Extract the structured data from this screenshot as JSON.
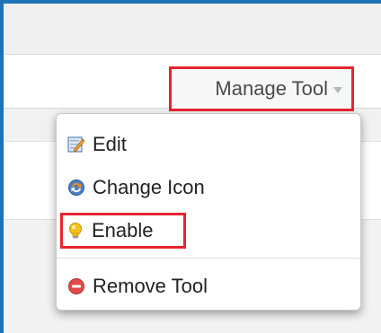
{
  "toolbar": {
    "manage_label": "Manage Tool"
  },
  "menu": {
    "items": [
      {
        "label": "Edit",
        "icon": "edit-icon"
      },
      {
        "label": "Change Icon",
        "icon": "change-icon-icon"
      },
      {
        "label": "Enable",
        "icon": "lightbulb-icon"
      },
      {
        "label": "Remove Tool",
        "icon": "remove-icon"
      }
    ]
  },
  "colors": {
    "window_border": "#1e73b6",
    "highlight_outline": "#e5252f",
    "remove_red": "#e04a48",
    "bulb_yellow": "#f4c21b"
  }
}
